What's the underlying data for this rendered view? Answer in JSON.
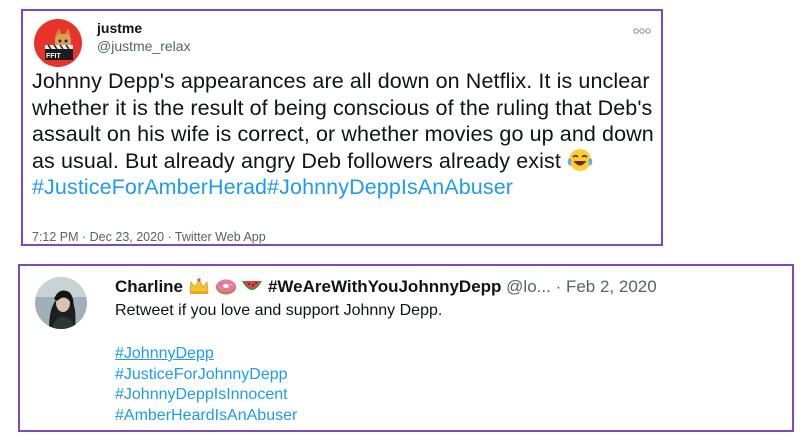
{
  "tweet1": {
    "display_name": "justme",
    "handle": "@justme_relax",
    "body_text": "Johnny Depp's appearances are all down on Netflix. It is unclear whether it is the result of being conscious of the ruling that Deb's assault on his wife is correct, or whether movies go up and down as usual. But already angry Deb followers already exist",
    "emoji_name": "face-with-tears-of-joy-emoji",
    "hashtags": "#JusticeForAmberHerad#JohnnyDeppIsAnAbuser",
    "timestamp": "7:12 PM · Dec 23, 2020 · Twitter Web App",
    "avatar_text": "FFIT"
  },
  "tweet2": {
    "display_name": "Charline",
    "display_hashtag": "#WeAreWithYouJohnnyDepp",
    "handle": "@lo...",
    "date": "· Feb 2, 2020",
    "body_text": "Retweet if you love and support Johnny Depp.",
    "hashtags": [
      "#JohnnyDepp",
      "#JusticeForJohnnyDepp",
      "#JohnnyDeppIsInnocent",
      "#AmberHeardIsAnAbuser"
    ],
    "name_icons": [
      "crown-icon",
      "donut-icon",
      "watermelon-icon"
    ]
  },
  "colors": {
    "border": "#7d4bb8",
    "link": "#1d9bf0",
    "muted": "#536471",
    "text": "#0f1419"
  }
}
